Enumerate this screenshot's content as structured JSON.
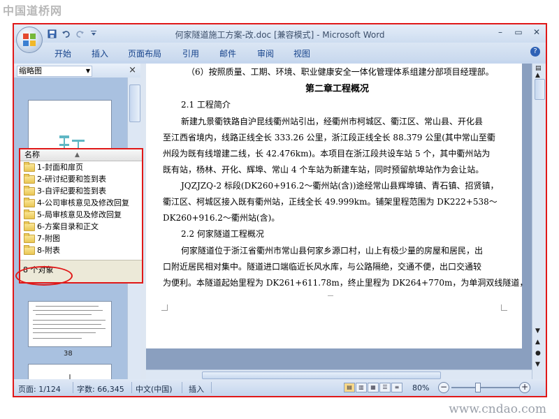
{
  "watermark": {
    "top": "中国道桥网",
    "bottom": "www.cndao.com"
  },
  "titlebar": {
    "title": "何家隧道施工方案-改.doc [兼容模式] - Microsoft Word",
    "qat": [
      "save-icon",
      "undo-icon",
      "redo-icon",
      "customize-icon"
    ],
    "controls": [
      "–",
      "▭",
      "✕"
    ]
  },
  "ribbon": {
    "tabs": [
      "开始",
      "插入",
      "页面布局",
      "引用",
      "邮件",
      "审阅",
      "视图"
    ],
    "help": "?"
  },
  "left_pane": {
    "view_selector": "缩略图",
    "close": "×",
    "page_number_label": "38"
  },
  "file_popup": {
    "column_header": "名称",
    "items": [
      "1-封面和扉页",
      "2-研讨纪要和签到表",
      "3-自评纪要和签到表",
      "4-公司审核意见及修改回复",
      "5-局审核意见及修改回复",
      "6-方案目录和正文",
      "7-附图",
      "8-附表"
    ],
    "status": "8 个对象"
  },
  "document": {
    "lines": [
      "（6）按照质量、工期、环境、职业健康安全一体化管理体系组建分部项目经理部。",
      "第二章工程概况",
      "2.1 工程简介",
      "新建九景衢铁路自沪昆线衢州站引出，经衢州市柯城区、衢江区、常山县、开化县",
      "至江西省境内，线路正线全长 333.26 公里，浙江段正线全长 88.379 公里(其中常山至衢",
      "州段为既有线增建二线，长 42.476km)。本项目在浙江段共设车站 5 个，其中衢州站为",
      "既有站，杨林、开化、辉埠、常山 4 个车站为新建车站，同时预留航埠站作为会让站。",
      "JQZJZQ-2 标段(DK260+916.2～衢州站(含))途经常山县辉埠镇、青石镇、招贤镇，",
      "衢江区、柯城区接入既有衢州站，正线全长 49.999km。铺架里程范围为 DK222+538～",
      "DK260+916.2～衢州站(含)。",
      "2.2 何家隧道工程概况",
      "何家隧道位于浙江省衢州市常山县何家乡源口村，山上有极少量的房屋和居民，出",
      "口附近居民相对集中。隧道进口端临近长风水库，与公路隔绝，交通不便，出口交通较",
      "为便利。本隧道起始里程为 DK261+611.78m，终止里程为 DK264+770m，为单洞双线隧道，"
    ]
  },
  "statusbar": {
    "page": "页面: 1/124",
    "words": "字数: 66,345",
    "language": "中文(中国)",
    "mode": "插入",
    "zoom": "80%",
    "zoom_minus": "−",
    "zoom_plus": "+",
    "zoom_level": 0.8
  },
  "colors": {
    "highlight": "#e01818",
    "accent": "#15428b"
  }
}
